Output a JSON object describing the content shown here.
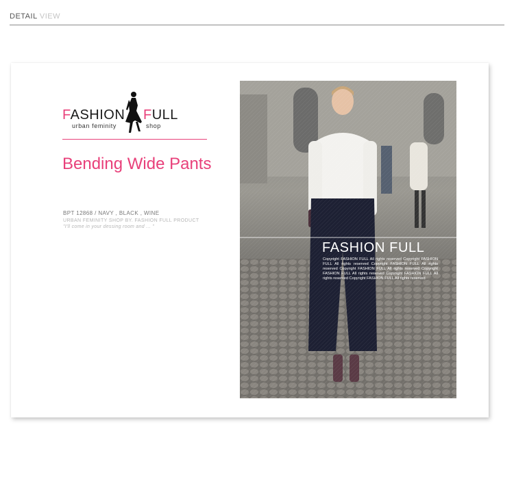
{
  "header": {
    "word1": "DETAIL",
    "word2": "VIEW"
  },
  "logo": {
    "left": "FASHION",
    "right": "FULL",
    "sub_left": "urban feminity",
    "sub_right": "shop",
    "icon": "woman-silhouette-icon"
  },
  "product": {
    "title": "Bending Wide Pants",
    "code_colors": "BPT 12868 / NAVY , BLACK , WINE",
    "shop_line": "URBAN FEMINITY SHOP BY. FASHION FULL PRODUCT",
    "quote": "\"I'll come in your dessing room and ... \""
  },
  "photo": {
    "brand": "FASHION FULL",
    "copyright": "Copyright FASHION FULL All rights reserved Copyright FASHION FULL All rights reserved Copyright FASHION FULL All rights reserved Copyright FASHION FULL All rights reserved Copyright FASHION FULL All rights reserved Copyright FASHION FULL All rights reserved Copyright FASHION FULL All rights reserved"
  },
  "colors": {
    "accent": "#e8407a",
    "header_dark": "#555555",
    "header_light": "#c4c4c4"
  }
}
